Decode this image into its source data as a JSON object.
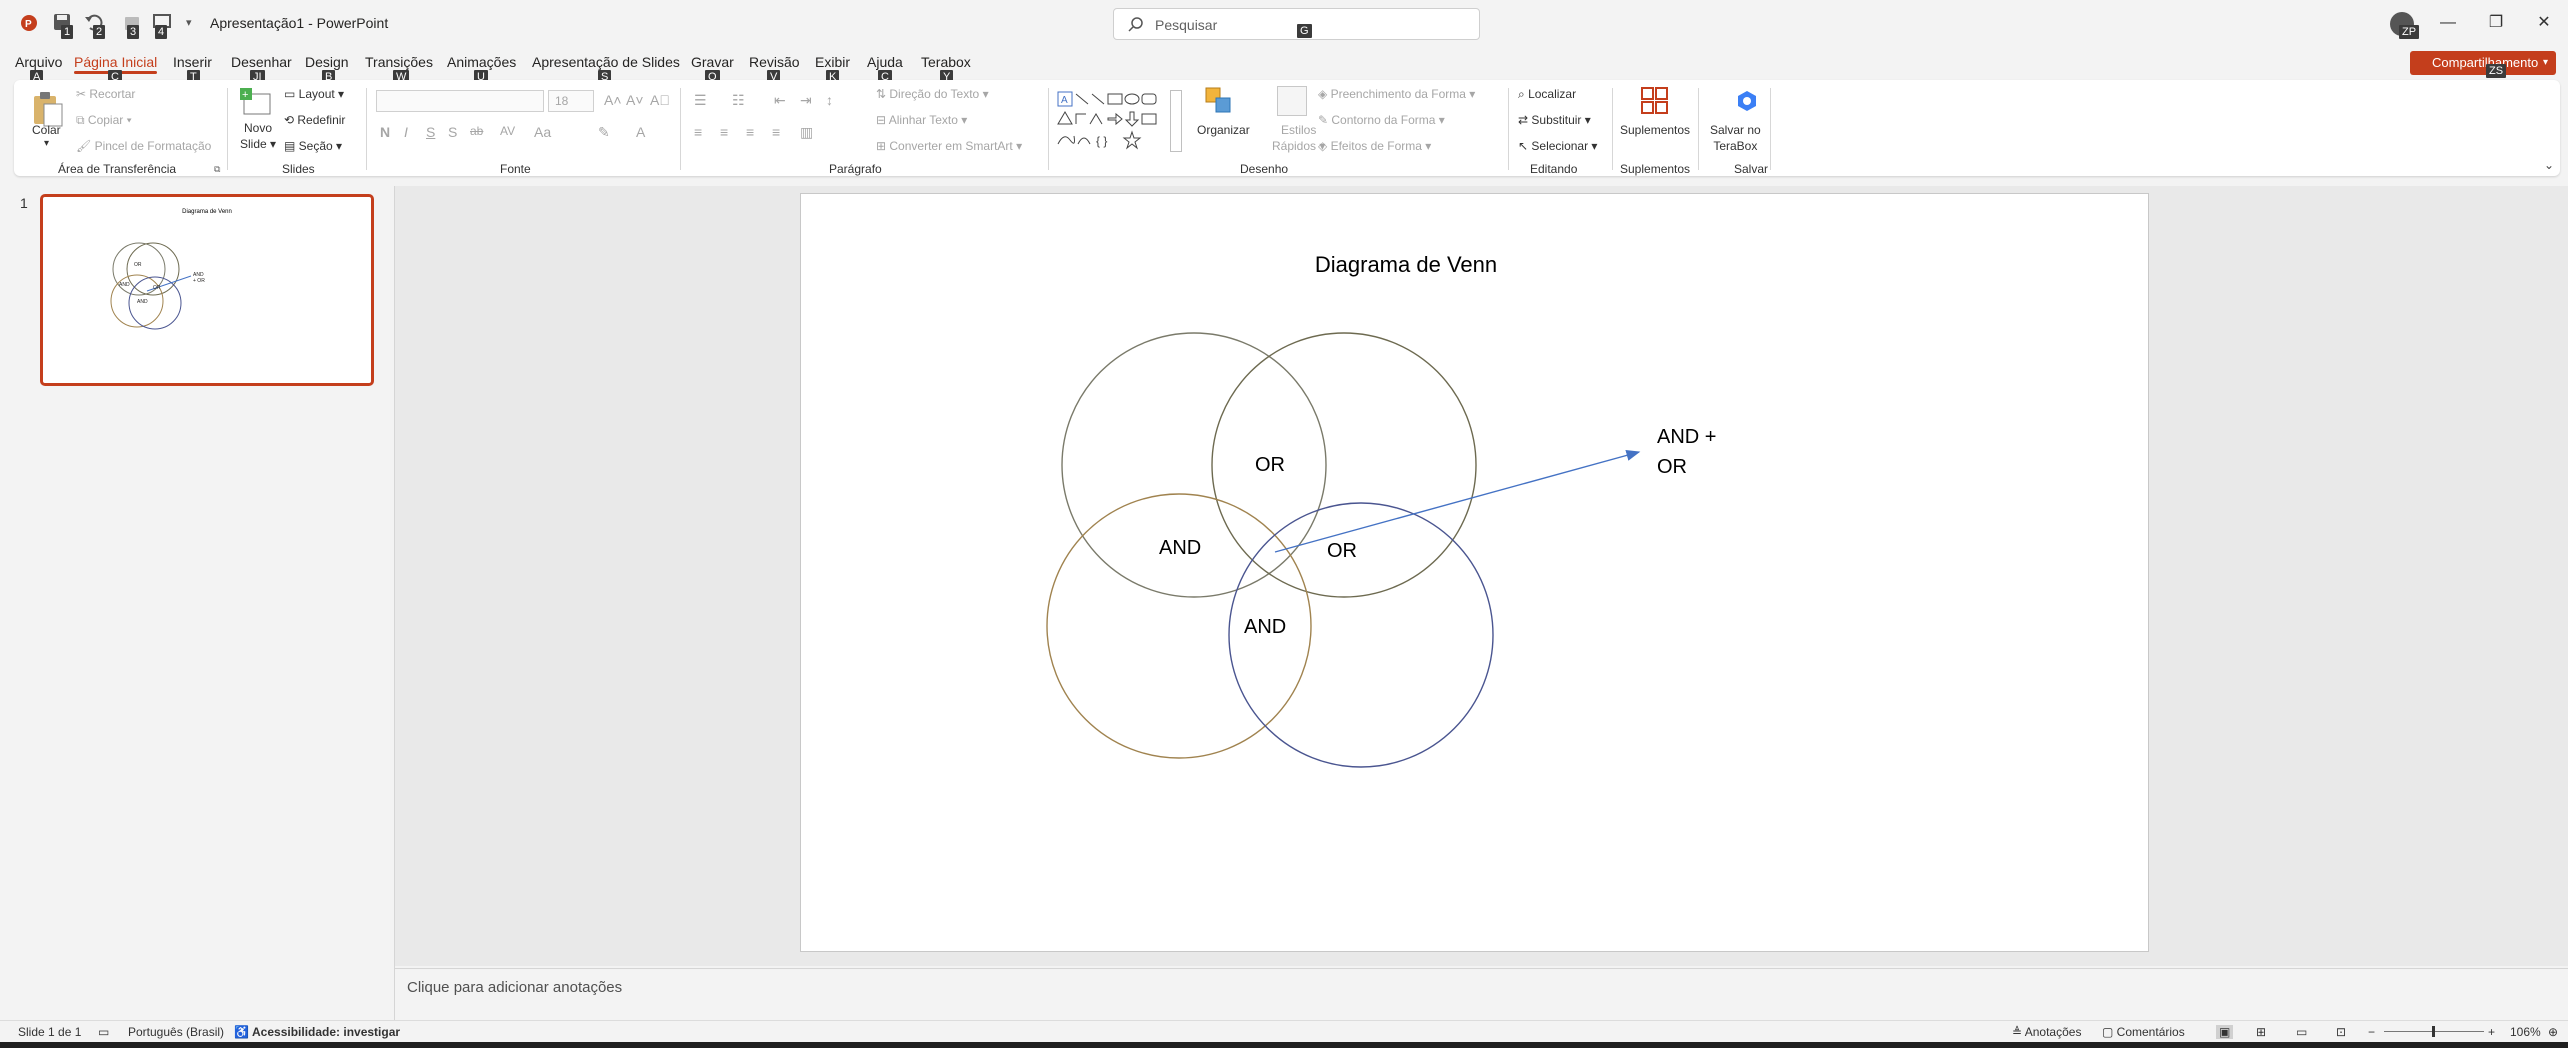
{
  "app": {
    "doc_title": "Apresentação1  -  PowerPoint",
    "search_placeholder": "Pesquisar",
    "search_keytip": "G",
    "share_label": "Compartilhamento",
    "share_keytip": "ZS",
    "avatar_keytip": "ZP",
    "accent_color": "#c43e1c"
  },
  "qat": {
    "keytips": [
      "1",
      "2",
      "3",
      "4"
    ]
  },
  "tabs": [
    {
      "label": "Arquivo",
      "keytip": "A"
    },
    {
      "label": "Página Inicial",
      "keytip": "C"
    },
    {
      "label": "Inserir",
      "keytip": "T"
    },
    {
      "label": "Desenhar",
      "keytip": "JI"
    },
    {
      "label": "Design",
      "keytip": "B"
    },
    {
      "label": "Transições",
      "keytip": "W"
    },
    {
      "label": "Animações",
      "keytip": "U"
    },
    {
      "label": "Apresentação de Slides",
      "keytip": "S"
    },
    {
      "label": "Gravar",
      "keytip": "O"
    },
    {
      "label": "Revisão",
      "keytip": "V"
    },
    {
      "label": "Exibir",
      "keytip": "K"
    },
    {
      "label": "Ajuda",
      "keytip": "Ç"
    },
    {
      "label": "Terabox",
      "keytip": "Y"
    }
  ],
  "ribbon": {
    "clipboard": {
      "paste": "Colar",
      "cut": "Recortar",
      "copy": "Copiar",
      "format_painter": "Pincel de Formatação",
      "group": "Área de Transferência"
    },
    "slides": {
      "new_slide": "Novo",
      "new_slide2": "Slide",
      "layout": "Layout",
      "reset": "Redefinir",
      "section": "Seção",
      "group": "Slides"
    },
    "font": {
      "size": "18",
      "group": "Fonte",
      "bold": "N",
      "italic": "I",
      "underline": "S",
      "shadow": "S",
      "strike": "ab",
      "spacing": "AV"
    },
    "paragraph": {
      "text_direction": "Direção do Texto",
      "align_text": "Alinhar Texto",
      "smartart": "Converter em SmartArt",
      "group": "Parágrafo"
    },
    "drawing": {
      "arrange": "Organizar",
      "quick_styles": "Estilos",
      "quick_styles2": "Rápidos",
      "shape_fill": "Preenchimento da Forma",
      "shape_outline": "Contorno da Forma",
      "shape_effects": "Efeitos de Forma",
      "group": "Desenho"
    },
    "editing": {
      "find": "Localizar",
      "replace": "Substituir",
      "select": "Selecionar",
      "group": "Editando"
    },
    "addins": {
      "label": "Suplementos",
      "group": "Suplementos"
    },
    "save": {
      "label": "Salvar no",
      "label2": "TeraBox",
      "group": "Salvar"
    }
  },
  "thumbnail": {
    "number": "1",
    "title": "Diagrama de Venn",
    "labels": {
      "or_top": "OR",
      "and_left": "AND",
      "or_right": "OR",
      "and_bottom": "AND",
      "annotation": "AND + OR"
    }
  },
  "slide": {
    "title": "Diagrama de Venn",
    "labels": {
      "or_top": "OR",
      "and_left": "AND",
      "or_right": "OR",
      "and_bottom": "AND",
      "annotation_line1": "AND +",
      "annotation_line2": "OR"
    },
    "circle_colors": {
      "top_left": "#7a7a6a",
      "top_right": "#6d6a50",
      "bottom_left": "#a0834f",
      "bottom_right": "#4a5590",
      "arrow": "#4472c4"
    }
  },
  "notes": {
    "placeholder": "Clique para adicionar anotações"
  },
  "status": {
    "slide_info": "Slide 1 de 1",
    "language": "Português (Brasil)",
    "accessibility": "Acessibilidade: investigar",
    "notes_btn": "Anotações",
    "comments_btn": "Comentários",
    "zoom": "106%"
  }
}
